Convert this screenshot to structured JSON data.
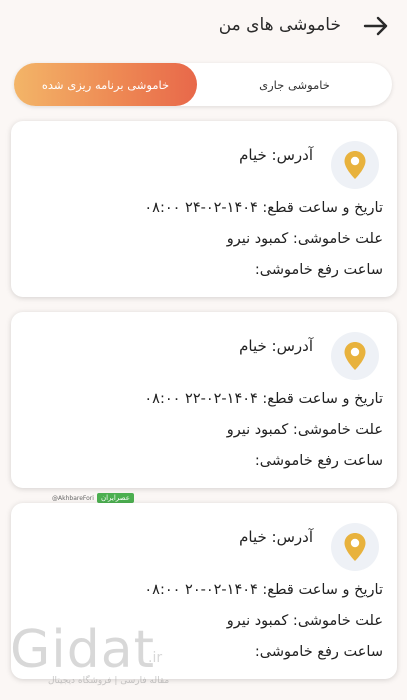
{
  "header": {
    "title": "خاموشی های من",
    "back_icon": "arrow-right-icon"
  },
  "tabs": [
    {
      "label": "خاموشی جاری",
      "active": false
    },
    {
      "label": "خاموشی برنامه ریزی شده",
      "active": true
    }
  ],
  "cards": [
    {
      "address": "آدرس: خیام",
      "cut_time": "تاریخ و ساعت قطع: ۱۴۰۴-۰۲-۲۴ ۰۸:۰۰",
      "reason": "علت خاموشی: کمبود نیرو",
      "restore_time": "ساعت رفع خاموشی:"
    },
    {
      "address": "آدرس: خیام",
      "cut_time": "تاریخ و ساعت قطع: ۱۴۰۴-۰۲-۲۲ ۰۸:۰۰",
      "reason": "علت خاموشی: کمبود نیرو",
      "restore_time": "ساعت رفع خاموشی:"
    },
    {
      "address": "آدرس: خیام",
      "cut_time": "تاریخ و ساعت قطع: ۱۴۰۴-۰۲-۲۰ ۰۸:۰۰",
      "reason": "علت خاموشی: کمبود نیرو",
      "restore_time": "ساعت رفع خاموشی:"
    }
  ],
  "colors": {
    "pin": "#e8b23d",
    "pin_bg": "#eef1f6",
    "tab_gradient_start": "#f3b568",
    "tab_gradient_end": "#e8684a"
  },
  "watermark": {
    "small_badge": "عصرایران",
    "small_text": "@AkhbareFori",
    "logo": "Gidat",
    "tld": ".ir",
    "subtitle": "مقاله فارسی | فروشگاه دیجیتال"
  }
}
